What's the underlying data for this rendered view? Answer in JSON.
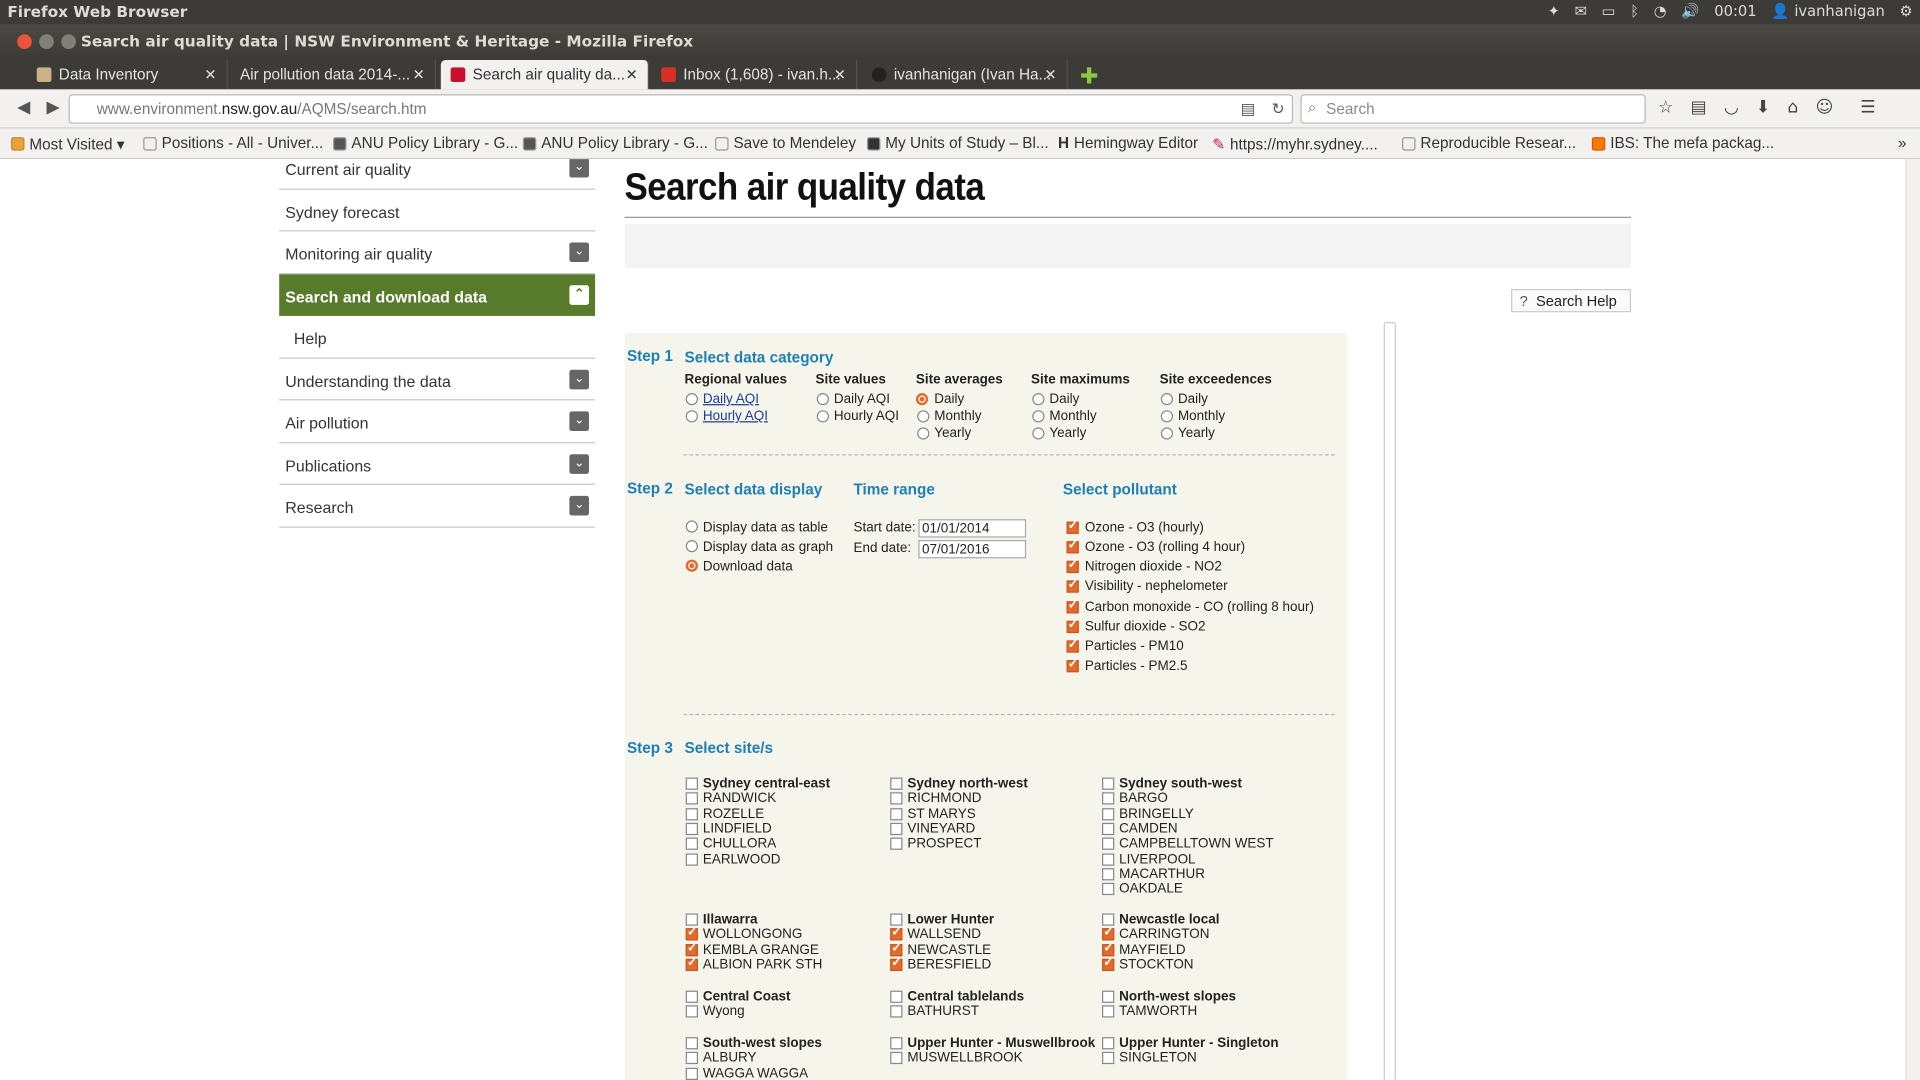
{
  "system": {
    "title": "Firefox Web Browser",
    "clock": "00:01",
    "user": "ivanhanigan"
  },
  "window": {
    "title": "Search air quality data | NSW Environment & Heritage - Mozilla Firefox"
  },
  "tabs": [
    {
      "label": "Data Inventory"
    },
    {
      "label": "Air pollution data 2014-..."
    },
    {
      "label": "Search air quality da..."
    },
    {
      "label": "Inbox (1,608) - ivan.h..."
    },
    {
      "label": "ivanhanigan (Ivan Ha..."
    }
  ],
  "nav": {
    "url_prefix": "www.environment.",
    "url_domain": "nsw.gov.au",
    "url_path": "/AQMS/search.htm",
    "search_placeholder": "Search"
  },
  "bookmarks": [
    {
      "label": "Most Visited ▾"
    },
    {
      "label": "Positions - All - Univer..."
    },
    {
      "label": "ANU Policy Library - G..."
    },
    {
      "label": "ANU Policy Library - G..."
    },
    {
      "label": "Save to Mendeley"
    },
    {
      "label": "My Units of Study – Bl..."
    },
    {
      "label": "Hemingway Editor"
    },
    {
      "label": "https://myhr.sydney...."
    },
    {
      "label": "Reproducible Resear..."
    },
    {
      "label": "IBS: The mefa packag..."
    }
  ],
  "sidenav": [
    {
      "label": "Current air quality"
    },
    {
      "label": "Sydney forecast"
    },
    {
      "label": "Monitoring air quality"
    },
    {
      "label": "Search and download data"
    },
    {
      "label": "Help"
    },
    {
      "label": "Understanding the data"
    },
    {
      "label": "Air pollution"
    },
    {
      "label": "Publications"
    },
    {
      "label": "Research"
    }
  ],
  "page": {
    "title": "Search air quality data",
    "help_button": "Search Help"
  },
  "step1": {
    "step": "Step 1",
    "title": "Select data category",
    "cols": [
      {
        "head": "Regional values",
        "opts": [
          "Daily AQI",
          "Hourly AQI"
        ]
      },
      {
        "head": "Site values",
        "opts": [
          "Daily AQI",
          "Hourly AQI"
        ]
      },
      {
        "head": "Site averages",
        "opts": [
          "Daily",
          "Monthly",
          "Yearly"
        ]
      },
      {
        "head": "Site maximums",
        "opts": [
          "Daily",
          "Monthly",
          "Yearly"
        ]
      },
      {
        "head": "Site exceedences",
        "opts": [
          "Daily",
          "Monthly",
          "Yearly"
        ]
      }
    ],
    "selected": "Site averages: Daily"
  },
  "step2": {
    "step": "Step 2",
    "display_title": "Select data display",
    "display_opts": [
      "Display data as table",
      "Display data as graph",
      "Download data"
    ],
    "time_title": "Time range",
    "start_label": "Start date:",
    "start_value": "01/01/2014",
    "end_label": "End date:",
    "end_value": "07/01/2016",
    "pollutant_title": "Select pollutant",
    "pollutants": [
      "Ozone - O3 (hourly)",
      "Ozone - O3 (rolling 4 hour)",
      "Nitrogen dioxide - NO2",
      "Visibility - nephelometer",
      "Carbon monoxide - CO (rolling 8 hour)",
      "Sulfur dioxide - SO2",
      "Particles - PM10",
      "Particles - PM2.5"
    ]
  },
  "step3": {
    "step": "Step 3",
    "title": "Select site/s",
    "groups": [
      {
        "region": "Sydney central-east",
        "sites": [
          "RANDWICK",
          "ROZELLE",
          "LINDFIELD",
          "CHULLORA",
          "EARLWOOD"
        ],
        "checked": false
      },
      {
        "region": "Sydney north-west",
        "sites": [
          "RICHMOND",
          "ST MARYS",
          "VINEYARD",
          "PROSPECT"
        ],
        "checked": false
      },
      {
        "region": "Sydney south-west",
        "sites": [
          "BARGO",
          "BRINGELLY",
          "CAMDEN",
          "CAMPBELLTOWN WEST",
          "LIVERPOOL",
          "MACARTHUR",
          "OAKDALE"
        ],
        "checked": false
      },
      {
        "region": "Illawarra",
        "sites": [
          "WOLLONGONG",
          "KEMBLA GRANGE",
          "ALBION PARK STH"
        ],
        "checked": true
      },
      {
        "region": "Lower Hunter",
        "sites": [
          "WALLSEND",
          "NEWCASTLE",
          "BERESFIELD"
        ],
        "checked": true
      },
      {
        "region": "Newcastle local",
        "sites": [
          "CARRINGTON",
          "MAYFIELD",
          "STOCKTON"
        ],
        "checked": true
      },
      {
        "region": "Central Coast",
        "sites": [
          "Wyong"
        ],
        "checked": false
      },
      {
        "region": "Central tablelands",
        "sites": [
          "BATHURST"
        ],
        "checked": false
      },
      {
        "region": "North-west slopes",
        "sites": [
          "TAMWORTH"
        ],
        "checked": false
      },
      {
        "region": "South-west slopes",
        "sites": [
          "ALBURY",
          "WAGGA WAGGA"
        ],
        "checked": false
      },
      {
        "region": "Upper Hunter - Muswellbrook",
        "sites": [
          "MUSWELLBROOK"
        ],
        "checked": false
      },
      {
        "region": "Upper Hunter - Singleton",
        "sites": [
          "SINGLETON"
        ],
        "checked": false
      }
    ]
  },
  "colors": {
    "accent_orange": "#e26a2c",
    "nav_green": "#587b2b",
    "heading_blue": "#1e7fb8"
  }
}
